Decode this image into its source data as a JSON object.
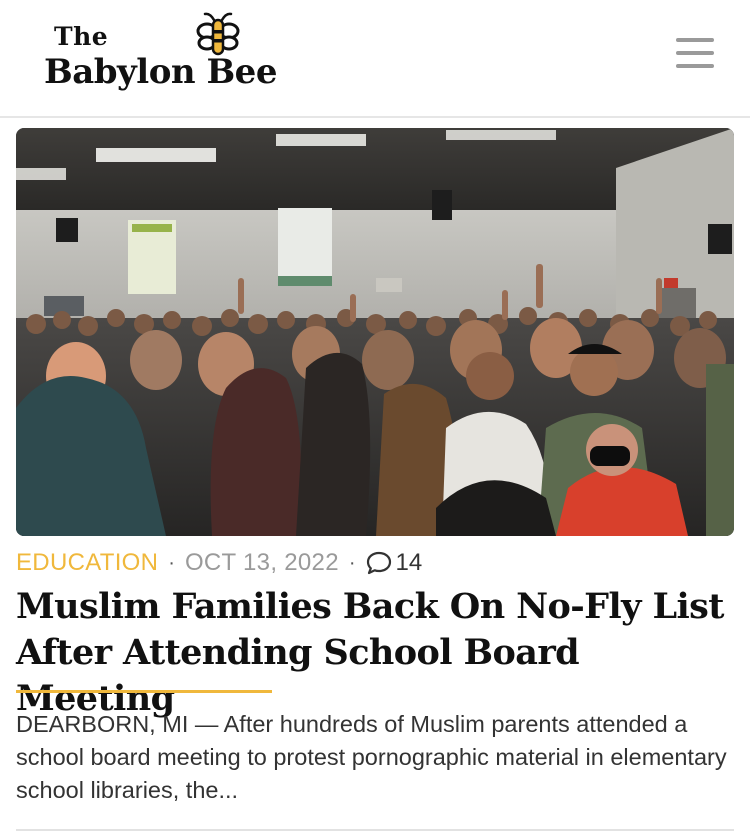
{
  "header": {
    "logo_the": "The",
    "logo_main": "Babylon Bee",
    "logo_icon": "bee-icon",
    "menu_icon": "hamburger-menu-icon"
  },
  "article": {
    "image_alt": "Crowded school board meeting room",
    "category": "EDUCATION",
    "date": "OCT 13, 2022",
    "separator": "·",
    "comment_icon": "comment-bubble-icon",
    "comment_count": "14",
    "headline": "Muslim Families Back On No-Fly List After Attending School Board Meeting",
    "excerpt": "DEARBORN, MI — After hundreds of Muslim parents attended a school board meeting to protest pornographic material in elementary school libraries, the..."
  },
  "colors": {
    "accent": "#f0b83c",
    "menu": "#9a9a9a",
    "text": "#111111"
  }
}
